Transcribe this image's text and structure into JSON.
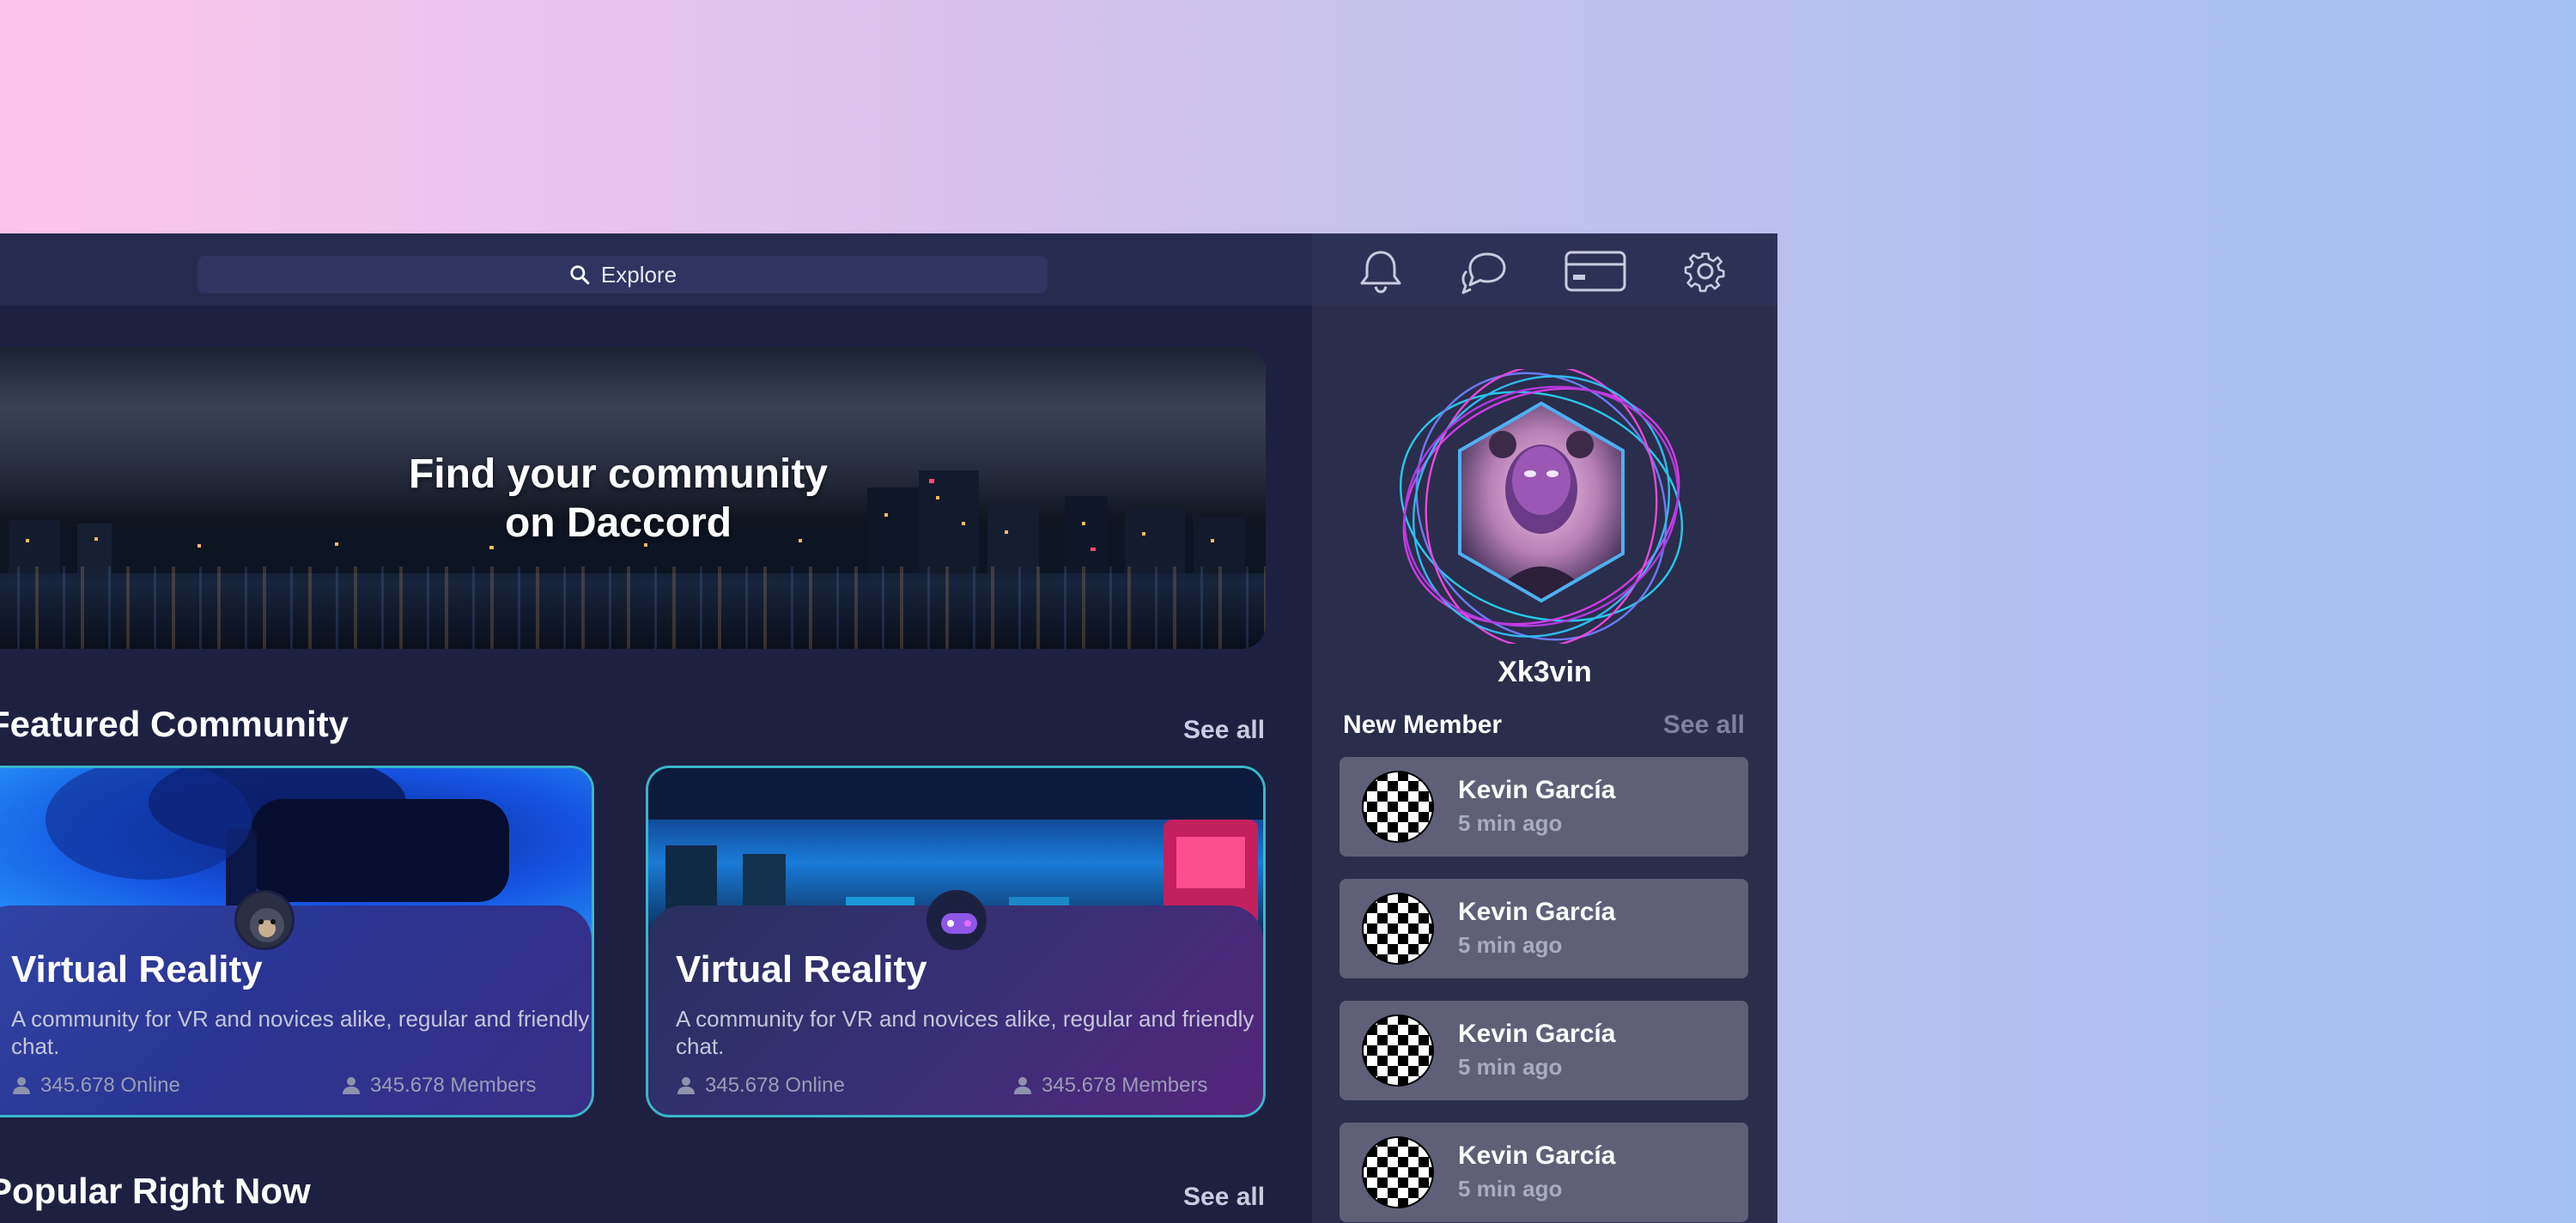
{
  "search": {
    "label": "Explore"
  },
  "hero": {
    "title_line1": "Find your community",
    "title_line2": "on Daccord"
  },
  "featured": {
    "title": "Featured Community",
    "see_all": "See all",
    "cards": [
      {
        "title": "Virtual Reality",
        "description": "A community for VR and novices alike, regular and friendly chat.",
        "online": "345.678 Online",
        "members": "345.678 Members"
      },
      {
        "title": "Virtual Reality",
        "description": "A community for VR and novices alike, regular and friendly chat.",
        "online": "345.678 Online",
        "members": "345.678 Members"
      }
    ]
  },
  "popular": {
    "title": "Popular Right Now",
    "see_all": "See all"
  },
  "header_icons": [
    "bell-icon",
    "chat-bubbles-icon",
    "credit-card-icon",
    "gear-icon"
  ],
  "profile": {
    "username": "Xk3vin"
  },
  "new_member": {
    "title": "New Member",
    "see_all": "See all",
    "items": [
      {
        "name": "Kevin García",
        "time": "5 min ago"
      },
      {
        "name": "Kevin García",
        "time": "5 min ago"
      },
      {
        "name": "Kevin García",
        "time": "5 min ago"
      },
      {
        "name": "Kevin García",
        "time": "5 min ago"
      }
    ]
  },
  "colors": {
    "accent_cyan": "#3ab6c9",
    "accent_magenta": "#d23be6",
    "panel": "#2b2d4c",
    "background": "#1e2042"
  }
}
